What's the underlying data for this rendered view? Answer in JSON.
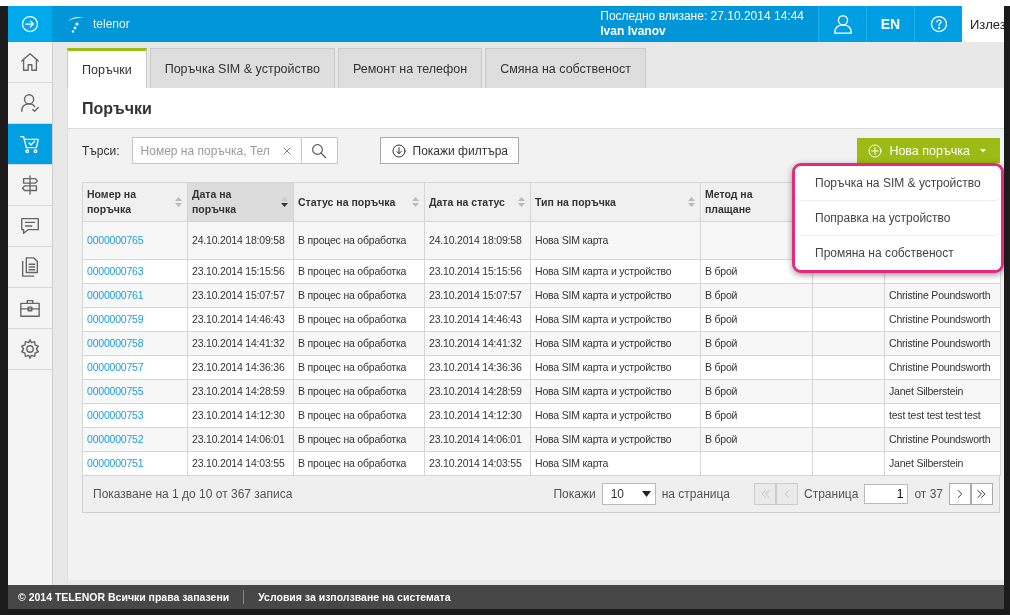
{
  "top_bar": {
    "logo": "telenor",
    "last_login": "Последно влизане: 27.10.2014 14:44",
    "user": "Ivan Ivanov",
    "language": "EN",
    "logout": "Излез"
  },
  "sidebar": {
    "items": [
      {
        "kind": "home",
        "selected": false
      },
      {
        "kind": "user",
        "selected": false
      },
      {
        "kind": "cart",
        "selected": true
      },
      {
        "kind": "signpost",
        "selected": false
      },
      {
        "kind": "chat",
        "selected": false
      },
      {
        "kind": "documents",
        "selected": false
      },
      {
        "kind": "briefcase",
        "selected": false
      },
      {
        "kind": "gear",
        "selected": false
      }
    ]
  },
  "tabs": [
    {
      "label": "Поръчки",
      "selected": true
    },
    {
      "label": "Поръчка SIM & устройство",
      "selected": false
    },
    {
      "label": "Ремонт на телефон",
      "selected": false
    },
    {
      "label": "Смяна на собственост",
      "selected": false
    }
  ],
  "page_title": "Поръчки",
  "toolbar": {
    "search_label": "Търси:",
    "search": {
      "placeholder": "Номер на поръчка, Тел"
    },
    "filter_button": "Покажи филтъра",
    "new_order_button": "Нова поръчка"
  },
  "dropdown": {
    "items": [
      "Поръчка на SIM & устройство",
      "Поправка на устройство",
      "Промяна на собственост"
    ]
  },
  "table": {
    "columns": [
      {
        "label": "Номер на поръчка",
        "sorted": false
      },
      {
        "label": "Дата на поръчка",
        "sorted": true
      },
      {
        "label": "Статус на поръчка",
        "sorted": false
      },
      {
        "label": "Дата на статус",
        "sorted": false
      },
      {
        "label": "Тип на поръчка",
        "sorted": false
      },
      {
        "label": "Метод на плащане",
        "sorted": false
      }
    ],
    "rows": [
      {
        "number": "0000000765",
        "order_date": "24.10.2014 18:09:58",
        "status": "В процес на обработка",
        "status_date": "24.10.2014 18:09:58",
        "type": "Нова SIM карта"
      },
      {
        "number": "0000000763",
        "order_date": "23.10.2014 15:15:56",
        "status": "В процес на обработка",
        "status_date": "23.10.2014 15:15:56",
        "type": "Нова SIM карта и устройство",
        "payment": "В брой"
      },
      {
        "number": "0000000761",
        "order_date": "23.10.2014 15:07:57",
        "status": "В процес на обработка",
        "status_date": "23.10.2014 15:07:57",
        "type": "Нова SIM карта и устройство",
        "payment": "В брой",
        "column_8": "Christine Poundsworth"
      },
      {
        "number": "0000000759",
        "order_date": "23.10.2014 14:46:43",
        "status": "В процес на обработка",
        "status_date": "23.10.2014 14:46:43",
        "type": "Нова SIM карта и устройство",
        "payment": "В брой",
        "column_8": "Christine Poundsworth"
      },
      {
        "number": "0000000758",
        "order_date": "23.10.2014 14:41:32",
        "status": "В процес на обработка",
        "status_date": "23.10.2014 14:41:32",
        "type": "Нова SIM карта и устройство",
        "payment": "В брой",
        "column_8": "Christine Poundsworth"
      },
      {
        "number": "0000000757",
        "order_date": "23.10.2014 14:36:36",
        "status": "В процес на обработка",
        "status_date": "23.10.2014 14:36:36",
        "type": "Нова SIM карта и устройство",
        "payment": "В брой",
        "column_8": "Christine Poundsworth"
      },
      {
        "number": "0000000755",
        "order_date": "23.10.2014 14:28:59",
        "status": "В процес на обработка",
        "status_date": "23.10.2014 14:28:59",
        "type": "Нова SIM карта и устройство",
        "payment": "В брой",
        "column_8": "Janet Silberstein"
      },
      {
        "number": "0000000753",
        "order_date": "23.10.2014 14:12:30",
        "status": "В процес на обработка",
        "status_date": "23.10.2014 14:12:30",
        "type": "Нова SIM карта и устройство",
        "payment": "В брой",
        "column_8": "test test test test test"
      },
      {
        "number": "0000000752",
        "order_date": "23.10.2014 14:06:01",
        "status": "В процес на обработка",
        "status_date": "23.10.2014 14:06:01",
        "type": "Нова SIM карта и устройство",
        "payment": "В брой",
        "column_8": "Christine Poundsworth"
      },
      {
        "number": "0000000751",
        "order_date": "23.10.2014 14:03:55",
        "status": "В процес на обработка",
        "status_date": "23.10.2014 14:03:55",
        "type": "Нова SIM карта",
        "column_8": "Janet Silberstein"
      }
    ]
  },
  "pagination": {
    "summary": "Показване на 1 до 10 от 367 записа",
    "show_label": "Покажи",
    "page_size": "10",
    "per_page_label": "на страница",
    "page_label": "Страница",
    "page": "1",
    "of_label": "от 37",
    "nav": [
      {
        "kind": "first",
        "disabled": true
      },
      {
        "kind": "prev",
        "disabled": true
      },
      {
        "kind": "next",
        "disabled": false
      },
      {
        "kind": "last",
        "disabled": false
      }
    ]
  },
  "footer": {
    "copyright": "© 2014 TELENOR Всички права запазени",
    "terms": "Условия за използване на системата"
  }
}
